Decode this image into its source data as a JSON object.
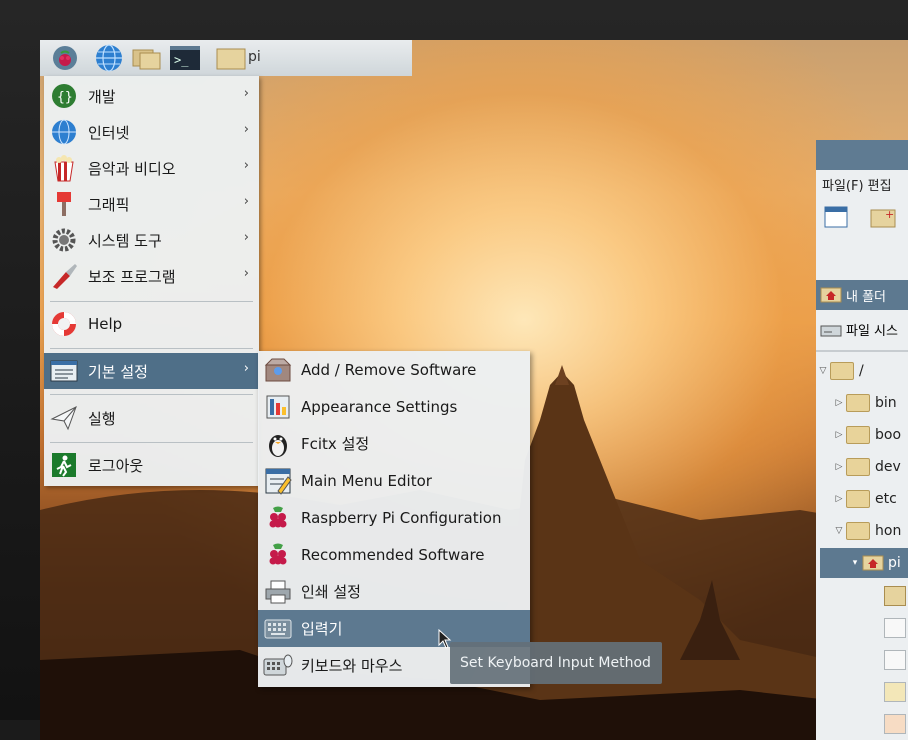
{
  "taskbar": {
    "icons": [
      "raspberry-menu-icon",
      "web-browser-icon",
      "file-manager-icon",
      "terminal-icon"
    ],
    "window_button_label": "pi"
  },
  "main_menu": {
    "items": [
      {
        "label": "개발",
        "icon": "programming-braces-icon",
        "has_submenu": true
      },
      {
        "label": "인터넷",
        "icon": "globe-icon",
        "has_submenu": true
      },
      {
        "label": "음악과 비디오",
        "icon": "popcorn-icon",
        "has_submenu": true
      },
      {
        "label": "그래픽",
        "icon": "paintbrush-icon",
        "has_submenu": true
      },
      {
        "label": "시스템 도구",
        "icon": "gear-icon",
        "has_submenu": true
      },
      {
        "label": "보조 프로그램",
        "icon": "knife-icon",
        "has_submenu": true
      },
      {
        "label": "Help",
        "icon": "lifebuoy-icon",
        "has_submenu": false
      },
      {
        "label": "기본 설정",
        "icon": "preferences-icon",
        "has_submenu": true,
        "active": true
      },
      {
        "label": "실행",
        "icon": "paper-plane-icon",
        "has_submenu": false
      },
      {
        "label": "로그아웃",
        "icon": "exit-icon",
        "has_submenu": false
      }
    ],
    "arrow_glyph": "›"
  },
  "submenu": {
    "items": [
      {
        "label": "Add / Remove Software",
        "icon": "package-icon"
      },
      {
        "label": "Appearance Settings",
        "icon": "appearance-icon"
      },
      {
        "label": "Fcitx 설정",
        "icon": "penguin-icon"
      },
      {
        "label": "Main Menu Editor",
        "icon": "menu-editor-icon"
      },
      {
        "label": "Raspberry Pi Configuration",
        "icon": "raspberry-icon"
      },
      {
        "label": "Recommended Software",
        "icon": "raspberry-icon"
      },
      {
        "label": "인쇄 설정",
        "icon": "printer-icon"
      },
      {
        "label": "입력기",
        "icon": "keyboard-icon",
        "active": true
      },
      {
        "label": "키보드와 마우스",
        "icon": "keyboard-mouse-icon"
      }
    ]
  },
  "tooltip": {
    "text": "Set Keyboard Input Method"
  },
  "file_manager": {
    "menubar": "파일(F)  편집",
    "places": [
      {
        "label": "내 폴더",
        "icon": "home-icon",
        "selected": true
      },
      {
        "label": "파일 시스",
        "icon": "drive-icon",
        "selected": false
      }
    ],
    "tree": [
      {
        "label": "/",
        "level": 0,
        "expanded": true
      },
      {
        "label": "bin",
        "level": 1
      },
      {
        "label": "boo",
        "level": 1
      },
      {
        "label": "dev",
        "level": 1
      },
      {
        "label": "etc",
        "level": 1
      },
      {
        "label": "hon",
        "level": 1,
        "expanded": true
      },
      {
        "label": "pi",
        "level": 2,
        "selected": true
      }
    ]
  },
  "colors": {
    "menu_bg": "#ecf0f2",
    "selection": "#5d7990",
    "tooltip_bg": "#647078"
  }
}
